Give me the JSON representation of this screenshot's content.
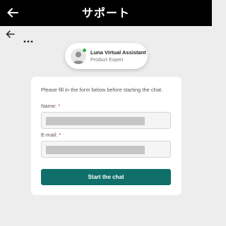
{
  "header": {
    "title": "サポート",
    "back_icon": "arrow-left-icon"
  },
  "subnav": {
    "back_icon": "arrow-left-icon",
    "more_icon": "more-dots-icon"
  },
  "agent": {
    "name": "Luna Virtual Assistant",
    "role": "Product Expert",
    "status": "online",
    "status_color": "#2eae47"
  },
  "form": {
    "intro": "Please fill in the form below before starting the chat.",
    "name_label": "Name:",
    "email_label": "E-mail:",
    "required_mark": "*",
    "name_value": "",
    "email_value": "",
    "submit_label": "Start the chat"
  },
  "colors": {
    "topbar": "#000000",
    "button": "#106f6a",
    "required": "#d0342c",
    "page_bg": "#ededed"
  }
}
